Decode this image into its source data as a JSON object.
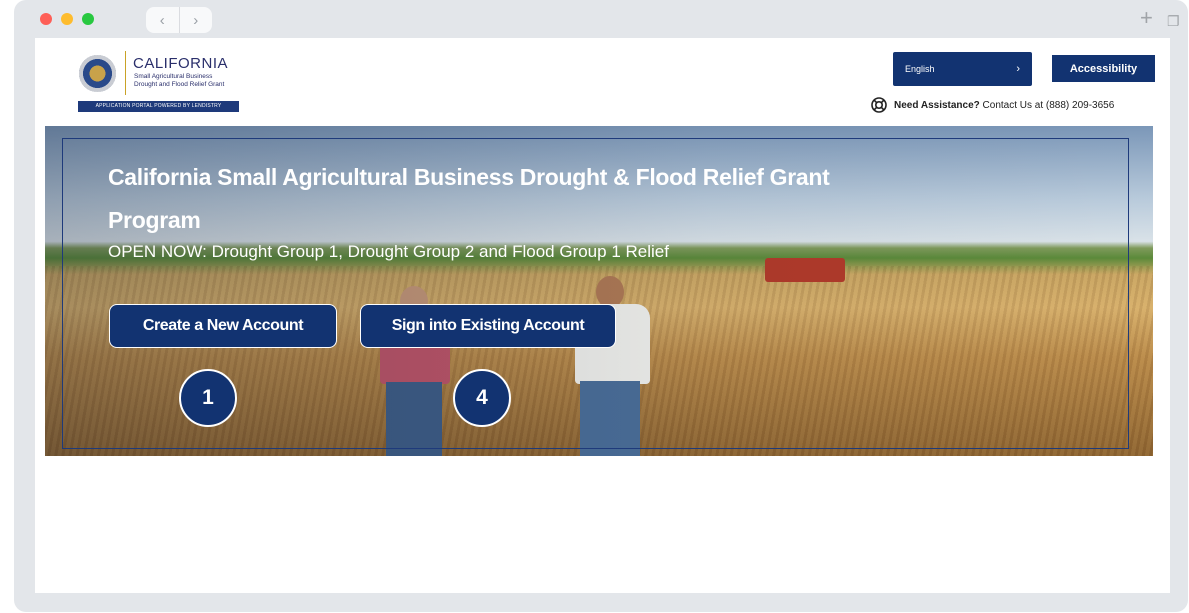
{
  "browser": {
    "dot_colors": [
      "#fe5f57",
      "#febc2e",
      "#28c840"
    ],
    "back_glyph": "‹",
    "forward_glyph": "›",
    "new_tab_glyph": "+",
    "tabs_glyph": "❐"
  },
  "header": {
    "logo_title": "CALIFORNIA",
    "logo_subtitle_line1": "Small Agricultural Business",
    "logo_subtitle_line2": "Drought and Flood Relief Grant",
    "portal_bar": "APPLICATION PORTAL POWERED BY LENDISTRY",
    "language_selected": "English",
    "language_chevron": "›",
    "accessibility_label": "Accessibility",
    "assistance_bold": "Need Assistance?",
    "assistance_text": " Contact Us at (888) 209-3656"
  },
  "hero": {
    "title": "California Small Agricultural Business Drought & Flood Relief Grant Program",
    "subtitle": "OPEN NOW: Drought Group 1, Drought Group 2 and Flood Group 1 Relief",
    "create_account_label": "Create a New Account",
    "signin_label": "Sign into Existing Account",
    "step_create": "1",
    "step_signin": "4"
  },
  "colors": {
    "brand_navy": "#123371",
    "portal_bar": "#1e3a7b",
    "logo_gold": "#c9a227",
    "frame_gray": "#e3e6ea"
  }
}
